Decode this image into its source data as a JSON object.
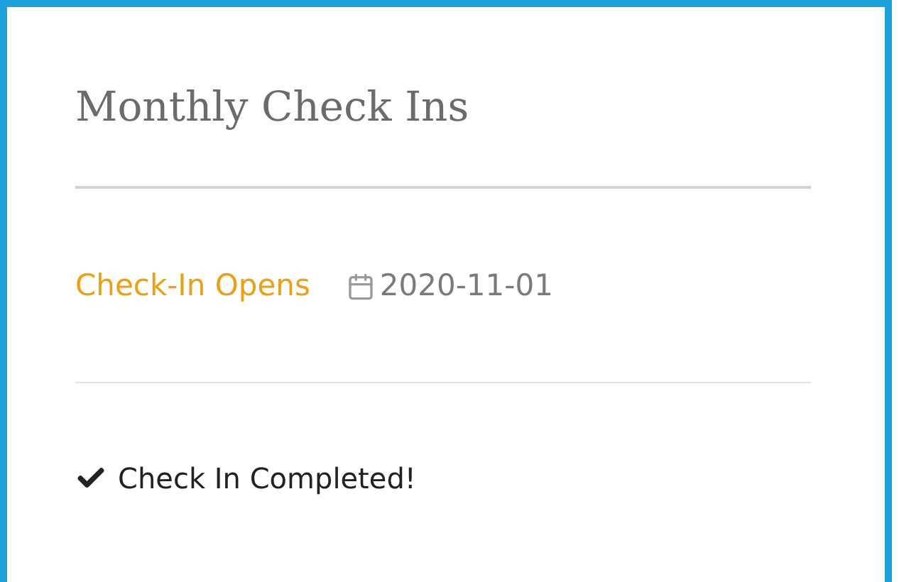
{
  "card": {
    "title": "Monthly Check Ins",
    "open_label": "Check-In Opens",
    "open_date": "2020-11-01",
    "status": "Check In Completed!"
  }
}
